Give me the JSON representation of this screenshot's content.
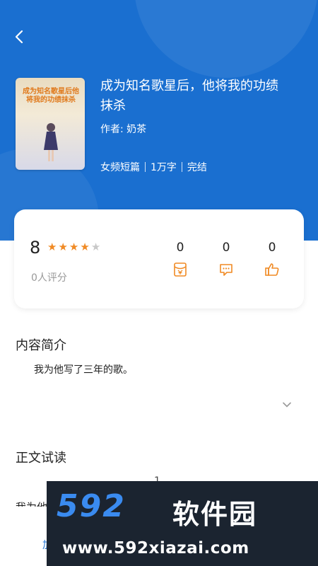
{
  "book": {
    "title_line1": "成为知名歌星后，他将我的功绩",
    "title_line2": "抹杀",
    "author": "作者: 奶茶",
    "category": "女频短篇",
    "word_count": "1万字",
    "status": "完结",
    "cover_text": "成为知名歌星后他将我的功绩抹杀"
  },
  "rating": {
    "score": "8",
    "stars_filled": 4,
    "stars_total": 5,
    "raters": "0人评分",
    "stats": [
      {
        "value": "0",
        "icon": "red-envelope-icon"
      },
      {
        "value": "0",
        "icon": "comment-icon"
      },
      {
        "value": "0",
        "icon": "thumbs-up-icon"
      }
    ]
  },
  "synopsis": {
    "heading": "内容简介",
    "text": "我为他写了三年的歌。"
  },
  "preview": {
    "heading": "正文试读",
    "chapter_number": "1",
    "first_line": "我为他"
  },
  "bottom": {
    "add_label": "加"
  },
  "watermark": {
    "logo_number": "592",
    "logo_text": "软件园",
    "url": "www.592xiazai.com"
  },
  "colors": {
    "header_blue": "#1a6fd0",
    "star_orange": "#f08a24",
    "star_gray": "#c8c8c8",
    "icon_orange": "#f08a24"
  }
}
